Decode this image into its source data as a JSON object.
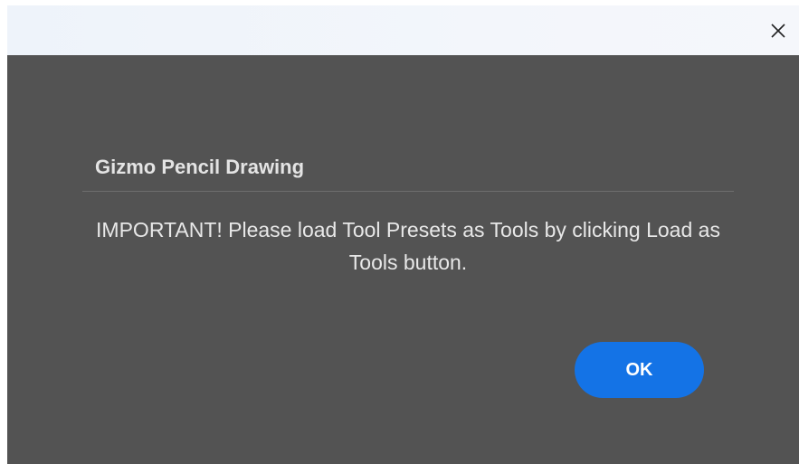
{
  "window": {
    "close_icon": "close-icon"
  },
  "dialog": {
    "title": "Gizmo Pencil Drawing",
    "message": "IMPORTANT! Please load Tool Presets as Tools by clicking Load as Tools button.",
    "ok_label": "OK"
  },
  "colors": {
    "background": "#535353",
    "titlebar": "#f3f6fb",
    "accent": "#1473e6",
    "text": "#e8e8e8"
  }
}
